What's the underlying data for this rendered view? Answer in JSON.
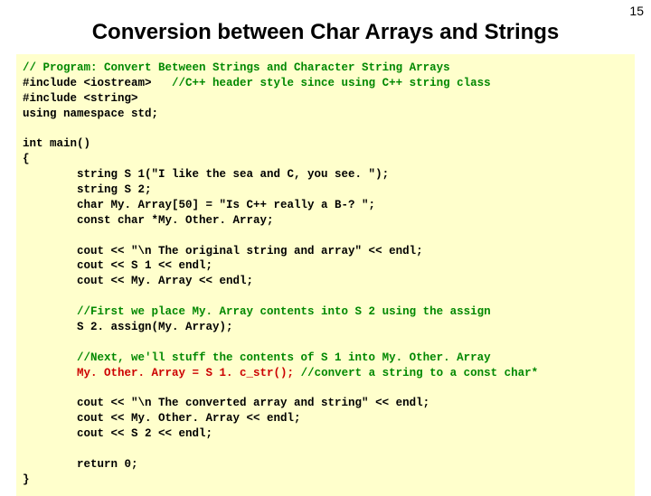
{
  "page_number": "15",
  "title": "Conversion between Char Arrays and Strings",
  "code": {
    "l1": "// Program: Convert Between Strings and Character String Arrays",
    "l2a": "#include <iostream>   ",
    "l2b": "//C++ header style since using C++ string class",
    "l3": "#include <string>",
    "l4": "using namespace std;",
    "l5": "",
    "l6": "int main()",
    "l7": "{",
    "l8": "        string S 1(\"I like the sea and C, you see. \");",
    "l9": "        string S 2;",
    "l10": "        char My. Array[50] = \"Is C++ really a B-? \";",
    "l11": "        const char *My. Other. Array;",
    "l12": "",
    "l13": "        cout << \"\\n The original string and array\" << endl;",
    "l14": "        cout << S 1 << endl;",
    "l15": "        cout << My. Array << endl;",
    "l16": "",
    "l17": "        //First we place My. Array contents into S 2 using the assign",
    "l18": "        S 2. assign(My. Array);",
    "l19": "",
    "l20": "        //Next, we'll stuff the contents of S 1 into My. Other. Array",
    "l21a": "        ",
    "l21b": "My. Other. Array = S 1. c_str();",
    "l21c": " //convert a string to a const char*",
    "l22": "",
    "l23": "        cout << \"\\n The converted array and string\" << endl;",
    "l24": "        cout << My. Other. Array << endl;",
    "l25": "        cout << S 2 << endl;",
    "l26": "",
    "l27": "        return 0;",
    "l28": "}"
  }
}
